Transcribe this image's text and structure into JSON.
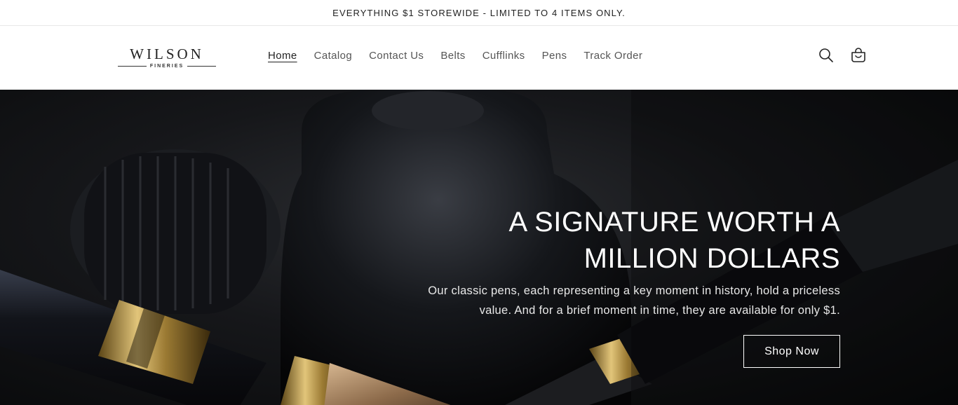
{
  "announcement": {
    "text": "EVERYTHING $1 STOREWIDE - LIMITED TO 4 ITEMS ONLY."
  },
  "logo": {
    "main": "WILSON",
    "sub": "FINERIES"
  },
  "nav": {
    "items": [
      {
        "label": "Home",
        "active": true
      },
      {
        "label": "Catalog"
      },
      {
        "label": "Contact Us"
      },
      {
        "label": "Belts"
      },
      {
        "label": "Cufflinks"
      },
      {
        "label": "Pens"
      },
      {
        "label": "Track Order"
      }
    ]
  },
  "header_icons": {
    "search": "search-icon",
    "cart": "cart-icon"
  },
  "hero": {
    "title_line1": "A SIGNATURE WORTH A",
    "title_line2": "MILLION DOLLARS",
    "desc_line1": "Our classic pens, each representing a key moment in history, hold a priceless",
    "desc_line2": "value. And for a brief moment in time, they are available for only $1.",
    "button_label": "Shop Now"
  }
}
